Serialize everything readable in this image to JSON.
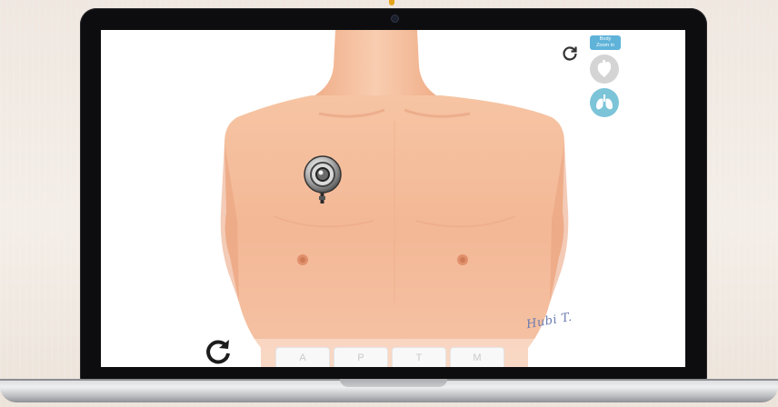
{
  "colors": {
    "skin": "#f2b894",
    "skin_shadow": "#e69a77",
    "accent_blue": "#5fb3d9",
    "lung_button": "#7cc4d8",
    "heart_button": "#d4d4d4"
  },
  "toolbar": {
    "zoom_label_line1": "Body",
    "zoom_label_line2": "Zoom in"
  },
  "icons": {
    "reset": "rotate-icon",
    "heart": "heart-icon",
    "lungs": "lungs-icon",
    "refresh": "refresh-icon",
    "stethoscope": "stethoscope-icon"
  },
  "tabs": [
    {
      "label": "A"
    },
    {
      "label": "P"
    },
    {
      "label": "T"
    },
    {
      "label": "M"
    }
  ],
  "artwork": {
    "signature": "Hubi T."
  }
}
